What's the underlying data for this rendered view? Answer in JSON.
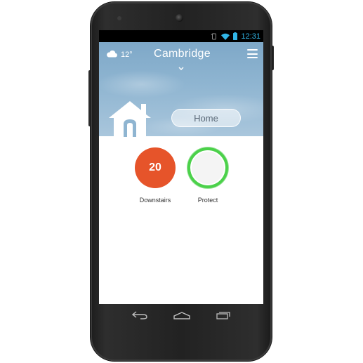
{
  "status_bar": {
    "time": "12:31",
    "accent_color": "#31b5e6",
    "icons": [
      "rotation-lock-icon",
      "wifi-icon",
      "battery-icon"
    ]
  },
  "header": {
    "weather": {
      "icon": "cloud-icon",
      "temperature": "12°"
    },
    "location": "Cambridge",
    "location_dropdown_icon": "chevron-down-icon",
    "menu_icon": "hamburger-menu-icon",
    "home_icon": "house-icon",
    "home_button_label": "Home"
  },
  "devices": [
    {
      "type": "thermostat",
      "label": "Downstairs",
      "value": "20",
      "color": "#e6542a"
    },
    {
      "type": "protect",
      "label": "Protect",
      "color": "#4bd14a"
    }
  ],
  "nav_bar": {
    "icons": [
      "back-icon",
      "home-nav-icon",
      "recent-apps-icon"
    ]
  }
}
